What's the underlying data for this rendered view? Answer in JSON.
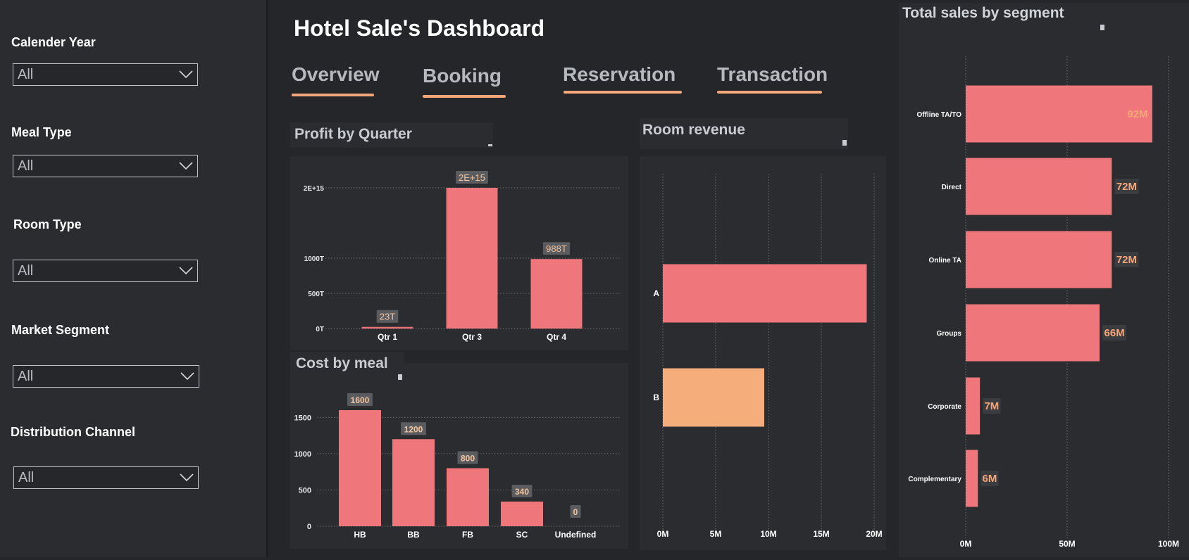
{
  "filters": [
    {
      "label": "Calender Year",
      "value": "All"
    },
    {
      "label": "Meal Type",
      "value": "All"
    },
    {
      "label": "Room Type",
      "value": "All"
    },
    {
      "label": "Market Segment",
      "value": "All"
    },
    {
      "label": "Distribution Channel",
      "value": "All"
    }
  ],
  "header": {
    "title": "Hotel Sale's Dashboard"
  },
  "tabs": [
    {
      "label": "Overview"
    },
    {
      "label": "Booking"
    },
    {
      "label": "Reservation"
    },
    {
      "label": "Transaction"
    }
  ],
  "colors": {
    "bar": "#ef767a",
    "accent": "#f5a77a",
    "label_bg": "#5a5c60",
    "grid": "#6b6e73"
  },
  "chart_data": [
    {
      "id": "profit",
      "type": "bar",
      "title": "Profit by Quarter",
      "categories": [
        "Qtr 1",
        "Qtr 3",
        "Qtr 4"
      ],
      "values": [
        23000000000000,
        2000000000000000,
        988000000000000
      ],
      "data_labels": [
        "23T",
        "2E+15",
        "988T"
      ],
      "ylim": [
        0,
        2000000000000000
      ],
      "yticks": [
        0,
        500000000000000,
        1000000000000000,
        2000000000000000
      ],
      "ytick_labels": [
        "0T",
        "500T",
        "1000T",
        "2E+15"
      ],
      "grid": true
    },
    {
      "id": "meal",
      "type": "bar",
      "title": "Cost by meal",
      "categories": [
        "HB",
        "BB",
        "FB",
        "SC",
        "Undefined"
      ],
      "values": [
        1600,
        1200,
        800,
        340,
        0
      ],
      "data_labels": [
        "1600",
        "1200",
        "800",
        "340",
        "0"
      ],
      "ylim": [
        0,
        1600
      ],
      "yticks": [
        0,
        500,
        1000,
        1500
      ],
      "ytick_labels": [
        "0",
        "500",
        "1000",
        "1500"
      ],
      "grid": true
    },
    {
      "id": "room",
      "type": "bar",
      "orientation": "horizontal",
      "title": "Room revenue",
      "categories": [
        "A",
        "B"
      ],
      "values": [
        19300000,
        9600000
      ],
      "bar_colors": [
        "#ef767a",
        "#f5ad7c"
      ],
      "xlim": [
        0,
        20000000
      ],
      "xticks": [
        0,
        5000000,
        10000000,
        15000000,
        20000000
      ],
      "xtick_labels": [
        "0M",
        "5M",
        "10M",
        "15M",
        "20M"
      ],
      "grid": true
    },
    {
      "id": "segment",
      "type": "bar",
      "orientation": "horizontal",
      "title": "Total sales by segment",
      "categories": [
        "Offline TA/TO",
        "Direct",
        "Online TA",
        "Groups",
        "Corporate",
        "Complementary"
      ],
      "values": [
        92000000,
        72000000,
        72000000,
        66000000,
        7000000,
        6000000
      ],
      "data_labels": [
        "92M",
        "72M",
        "72M",
        "66M",
        "7M",
        "6M"
      ],
      "xlim": [
        0,
        100000000
      ],
      "xticks": [
        0,
        50000000,
        100000000
      ],
      "xtick_labels": [
        "0M",
        "50M",
        "100M"
      ],
      "grid": true
    }
  ]
}
